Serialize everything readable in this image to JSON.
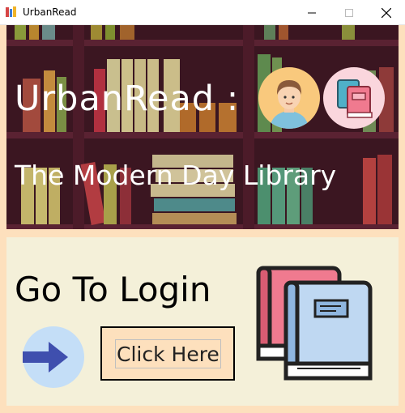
{
  "window": {
    "title": "UrbanRead",
    "controls": [
      "minimize",
      "maximize",
      "close"
    ]
  },
  "banner": {
    "headline": "UrbanRead :",
    "subtitle": "The Modern Day Library",
    "icons": [
      "avatar-icon",
      "books-icon"
    ]
  },
  "login": {
    "heading": "Go To Login",
    "button_label": "Click Here",
    "icons": [
      "arrow-right-icon",
      "books-icon"
    ]
  },
  "colors": {
    "banner_background": "#3b1621",
    "frame_background": "#fde0bd",
    "panel_background": "#f4f0d9",
    "arrow_circle": "#c4def7",
    "arrow": "#3f4fae",
    "book_pink": "#f07a8f",
    "book_blue": "#bfd8f2"
  }
}
